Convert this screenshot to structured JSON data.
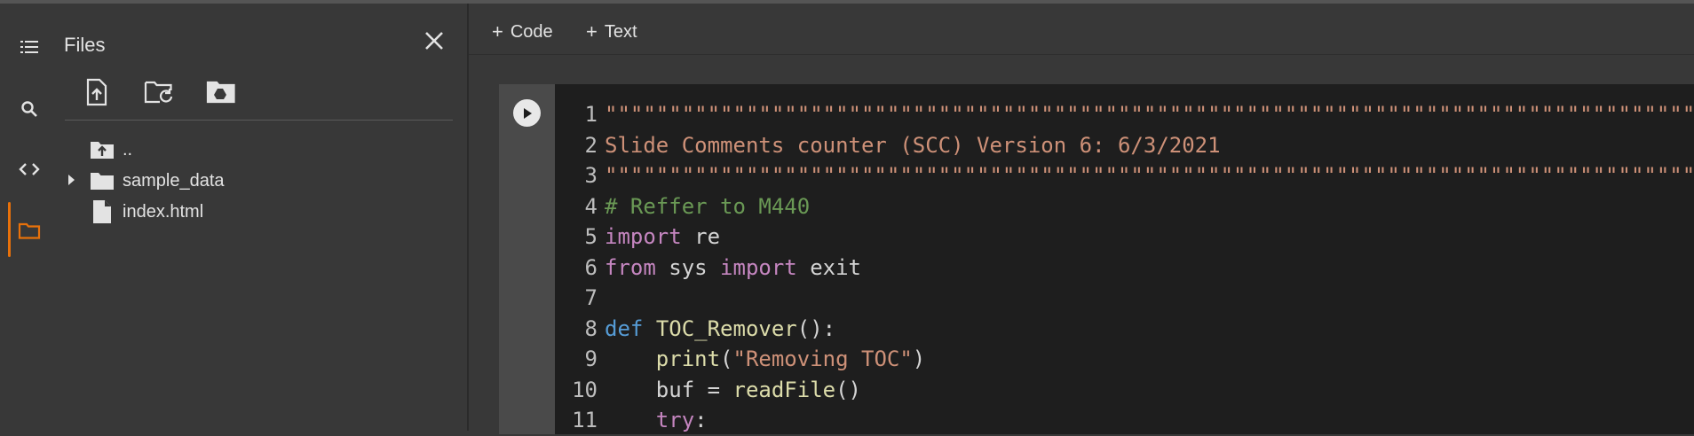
{
  "sidebar": {
    "icons": [
      "table-of-contents-icon",
      "search-icon",
      "code-snippets-icon",
      "folder-icon"
    ],
    "active_color": "#e8710a"
  },
  "files_panel": {
    "title": "Files",
    "toolbar": [
      "upload-icon",
      "refresh-icon",
      "mount-drive-icon"
    ],
    "items": [
      {
        "label": "..",
        "icon": "folder-up-icon"
      },
      {
        "label": "sample_data",
        "icon": "folder-icon"
      },
      {
        "label": "index.html",
        "icon": "file-icon"
      }
    ]
  },
  "toolbar": {
    "add_code_label": "Code",
    "add_text_label": "Text"
  },
  "code_cell": {
    "lines": [
      {
        "n": "1",
        "parts": [
          {
            "t": "\"\"\"\"\"\"\"\"\"\"\"\"\"\"\"\"\"\"\"\"\"\"\"\"\"\"\"\"\"\"\"\"\"\"\"\"\"\"\"\"\"\"\"\"\"\"\"\"\"\"\"\"\"\"\"\"\"\"\"\"\"\"\"\"\"\"\"\"\"\"\"\"\"\"\"\"\"\"\"\"\"\"\"\"\"\"\"",
            "c": "str"
          }
        ]
      },
      {
        "n": "2",
        "parts": [
          {
            "t": "Slide Comments counter (SCC) Version 6: 6/3/2021",
            "c": "str"
          }
        ]
      },
      {
        "n": "3",
        "parts": [
          {
            "t": "\"\"\"\"\"\"\"\"\"\"\"\"\"\"\"\"\"\"\"\"\"\"\"\"\"\"\"\"\"\"\"\"\"\"\"\"\"\"\"\"\"\"\"\"\"\"\"\"\"\"\"\"\"\"\"\"\"\"\"\"\"\"\"\"\"\"\"\"\"\"\"\"\"\"\"\"\"\"\"\"\"\"\"\"\"\"\"",
            "c": "str"
          }
        ]
      },
      {
        "n": "4",
        "parts": [
          {
            "t": "# Reffer to M440",
            "c": "cmt"
          }
        ]
      },
      {
        "n": "5",
        "parts": [
          {
            "t": "import",
            "c": "kw"
          },
          {
            "t": " re",
            "c": "txt"
          }
        ]
      },
      {
        "n": "6",
        "parts": [
          {
            "t": "from",
            "c": "kw"
          },
          {
            "t": " sys ",
            "c": "txt"
          },
          {
            "t": "import",
            "c": "kw"
          },
          {
            "t": " exit",
            "c": "txt"
          }
        ]
      },
      {
        "n": "7",
        "parts": []
      },
      {
        "n": "8",
        "parts": [
          {
            "t": "def",
            "c": "kw2"
          },
          {
            "t": " ",
            "c": "txt"
          },
          {
            "t": "TOC_Remover",
            "c": "fn"
          },
          {
            "t": "():",
            "c": "txt"
          }
        ]
      },
      {
        "n": "9",
        "parts": [
          {
            "t": "    ",
            "c": "txt"
          },
          {
            "t": "print",
            "c": "fn"
          },
          {
            "t": "(",
            "c": "txt"
          },
          {
            "t": "\"Removing TOC\"",
            "c": "str"
          },
          {
            "t": ")",
            "c": "txt"
          }
        ]
      },
      {
        "n": "10",
        "parts": [
          {
            "t": "    buf = ",
            "c": "txt"
          },
          {
            "t": "readFile",
            "c": "fn"
          },
          {
            "t": "()",
            "c": "txt"
          }
        ]
      },
      {
        "n": "11",
        "parts": [
          {
            "t": "    ",
            "c": "txt"
          },
          {
            "t": "try",
            "c": "kw"
          },
          {
            "t": ":",
            "c": "txt"
          }
        ]
      }
    ]
  }
}
